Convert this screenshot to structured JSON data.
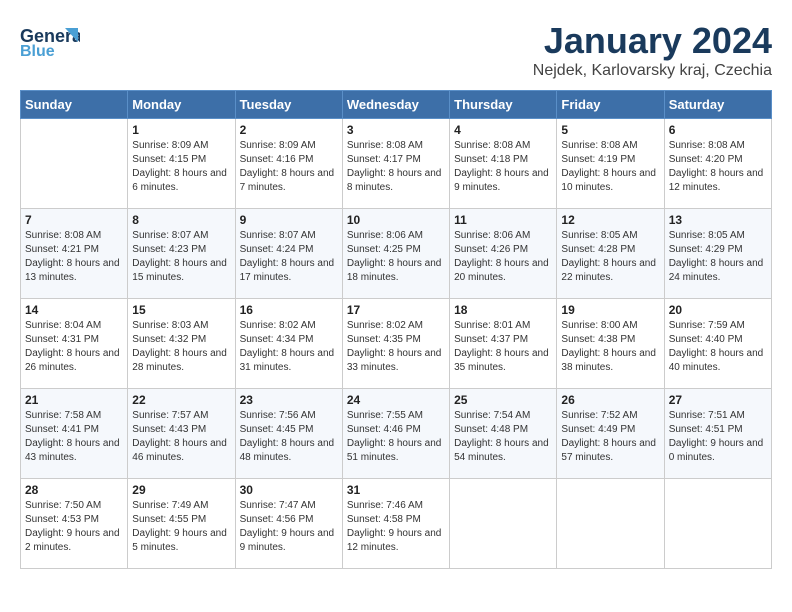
{
  "header": {
    "logo_line1": "General",
    "logo_line2": "Blue",
    "month": "January 2024",
    "location": "Nejdek, Karlovarsky kraj, Czechia"
  },
  "weekdays": [
    "Sunday",
    "Monday",
    "Tuesday",
    "Wednesday",
    "Thursday",
    "Friday",
    "Saturday"
  ],
  "weeks": [
    [
      {
        "day": "",
        "sunrise": "",
        "sunset": "",
        "daylight": ""
      },
      {
        "day": "1",
        "sunrise": "Sunrise: 8:09 AM",
        "sunset": "Sunset: 4:15 PM",
        "daylight": "Daylight: 8 hours and 6 minutes."
      },
      {
        "day": "2",
        "sunrise": "Sunrise: 8:09 AM",
        "sunset": "Sunset: 4:16 PM",
        "daylight": "Daylight: 8 hours and 7 minutes."
      },
      {
        "day": "3",
        "sunrise": "Sunrise: 8:08 AM",
        "sunset": "Sunset: 4:17 PM",
        "daylight": "Daylight: 8 hours and 8 minutes."
      },
      {
        "day": "4",
        "sunrise": "Sunrise: 8:08 AM",
        "sunset": "Sunset: 4:18 PM",
        "daylight": "Daylight: 8 hours and 9 minutes."
      },
      {
        "day": "5",
        "sunrise": "Sunrise: 8:08 AM",
        "sunset": "Sunset: 4:19 PM",
        "daylight": "Daylight: 8 hours and 10 minutes."
      },
      {
        "day": "6",
        "sunrise": "Sunrise: 8:08 AM",
        "sunset": "Sunset: 4:20 PM",
        "daylight": "Daylight: 8 hours and 12 minutes."
      }
    ],
    [
      {
        "day": "7",
        "sunrise": "Sunrise: 8:08 AM",
        "sunset": "Sunset: 4:21 PM",
        "daylight": "Daylight: 8 hours and 13 minutes."
      },
      {
        "day": "8",
        "sunrise": "Sunrise: 8:07 AM",
        "sunset": "Sunset: 4:23 PM",
        "daylight": "Daylight: 8 hours and 15 minutes."
      },
      {
        "day": "9",
        "sunrise": "Sunrise: 8:07 AM",
        "sunset": "Sunset: 4:24 PM",
        "daylight": "Daylight: 8 hours and 17 minutes."
      },
      {
        "day": "10",
        "sunrise": "Sunrise: 8:06 AM",
        "sunset": "Sunset: 4:25 PM",
        "daylight": "Daylight: 8 hours and 18 minutes."
      },
      {
        "day": "11",
        "sunrise": "Sunrise: 8:06 AM",
        "sunset": "Sunset: 4:26 PM",
        "daylight": "Daylight: 8 hours and 20 minutes."
      },
      {
        "day": "12",
        "sunrise": "Sunrise: 8:05 AM",
        "sunset": "Sunset: 4:28 PM",
        "daylight": "Daylight: 8 hours and 22 minutes."
      },
      {
        "day": "13",
        "sunrise": "Sunrise: 8:05 AM",
        "sunset": "Sunset: 4:29 PM",
        "daylight": "Daylight: 8 hours and 24 minutes."
      }
    ],
    [
      {
        "day": "14",
        "sunrise": "Sunrise: 8:04 AM",
        "sunset": "Sunset: 4:31 PM",
        "daylight": "Daylight: 8 hours and 26 minutes."
      },
      {
        "day": "15",
        "sunrise": "Sunrise: 8:03 AM",
        "sunset": "Sunset: 4:32 PM",
        "daylight": "Daylight: 8 hours and 28 minutes."
      },
      {
        "day": "16",
        "sunrise": "Sunrise: 8:02 AM",
        "sunset": "Sunset: 4:34 PM",
        "daylight": "Daylight: 8 hours and 31 minutes."
      },
      {
        "day": "17",
        "sunrise": "Sunrise: 8:02 AM",
        "sunset": "Sunset: 4:35 PM",
        "daylight": "Daylight: 8 hours and 33 minutes."
      },
      {
        "day": "18",
        "sunrise": "Sunrise: 8:01 AM",
        "sunset": "Sunset: 4:37 PM",
        "daylight": "Daylight: 8 hours and 35 minutes."
      },
      {
        "day": "19",
        "sunrise": "Sunrise: 8:00 AM",
        "sunset": "Sunset: 4:38 PM",
        "daylight": "Daylight: 8 hours and 38 minutes."
      },
      {
        "day": "20",
        "sunrise": "Sunrise: 7:59 AM",
        "sunset": "Sunset: 4:40 PM",
        "daylight": "Daylight: 8 hours and 40 minutes."
      }
    ],
    [
      {
        "day": "21",
        "sunrise": "Sunrise: 7:58 AM",
        "sunset": "Sunset: 4:41 PM",
        "daylight": "Daylight: 8 hours and 43 minutes."
      },
      {
        "day": "22",
        "sunrise": "Sunrise: 7:57 AM",
        "sunset": "Sunset: 4:43 PM",
        "daylight": "Daylight: 8 hours and 46 minutes."
      },
      {
        "day": "23",
        "sunrise": "Sunrise: 7:56 AM",
        "sunset": "Sunset: 4:45 PM",
        "daylight": "Daylight: 8 hours and 48 minutes."
      },
      {
        "day": "24",
        "sunrise": "Sunrise: 7:55 AM",
        "sunset": "Sunset: 4:46 PM",
        "daylight": "Daylight: 8 hours and 51 minutes."
      },
      {
        "day": "25",
        "sunrise": "Sunrise: 7:54 AM",
        "sunset": "Sunset: 4:48 PM",
        "daylight": "Daylight: 8 hours and 54 minutes."
      },
      {
        "day": "26",
        "sunrise": "Sunrise: 7:52 AM",
        "sunset": "Sunset: 4:49 PM",
        "daylight": "Daylight: 8 hours and 57 minutes."
      },
      {
        "day": "27",
        "sunrise": "Sunrise: 7:51 AM",
        "sunset": "Sunset: 4:51 PM",
        "daylight": "Daylight: 9 hours and 0 minutes."
      }
    ],
    [
      {
        "day": "28",
        "sunrise": "Sunrise: 7:50 AM",
        "sunset": "Sunset: 4:53 PM",
        "daylight": "Daylight: 9 hours and 2 minutes."
      },
      {
        "day": "29",
        "sunrise": "Sunrise: 7:49 AM",
        "sunset": "Sunset: 4:55 PM",
        "daylight": "Daylight: 9 hours and 5 minutes."
      },
      {
        "day": "30",
        "sunrise": "Sunrise: 7:47 AM",
        "sunset": "Sunset: 4:56 PM",
        "daylight": "Daylight: 9 hours and 9 minutes."
      },
      {
        "day": "31",
        "sunrise": "Sunrise: 7:46 AM",
        "sunset": "Sunset: 4:58 PM",
        "daylight": "Daylight: 9 hours and 12 minutes."
      },
      {
        "day": "",
        "sunrise": "",
        "sunset": "",
        "daylight": ""
      },
      {
        "day": "",
        "sunrise": "",
        "sunset": "",
        "daylight": ""
      },
      {
        "day": "",
        "sunrise": "",
        "sunset": "",
        "daylight": ""
      }
    ]
  ]
}
